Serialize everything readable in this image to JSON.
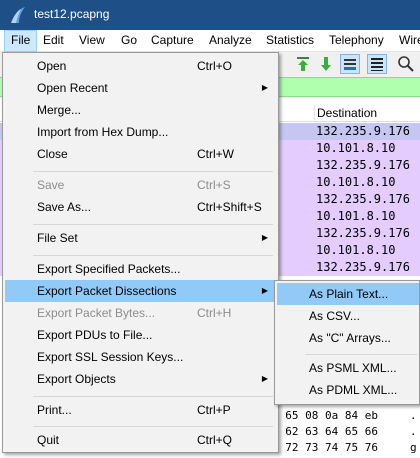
{
  "window": {
    "title": "test12.pcapng"
  },
  "menubar": {
    "items": [
      {
        "label": "File"
      },
      {
        "label": "Edit"
      },
      {
        "label": "View"
      },
      {
        "label": "Go"
      },
      {
        "label": "Capture"
      },
      {
        "label": "Analyze"
      },
      {
        "label": "Statistics"
      },
      {
        "label": "Telephony"
      },
      {
        "label": "Wire"
      }
    ]
  },
  "packet_list": {
    "destination_header": "Destination",
    "rows": [
      {
        "destination": "132.235.9.176",
        "color": "#c6c6f2"
      },
      {
        "destination": "10.101.8.10",
        "color": "#e4ccff"
      },
      {
        "destination": "132.235.9.176",
        "color": "#e4ccff"
      },
      {
        "destination": "10.101.8.10",
        "color": "#e4ccff"
      },
      {
        "destination": "132.235.9.176",
        "color": "#e4ccff"
      },
      {
        "destination": "10.101.8.10",
        "color": "#e4ccff"
      },
      {
        "destination": "132.235.9.176",
        "color": "#e4ccff"
      },
      {
        "destination": "10.101.8.10",
        "color": "#e4ccff"
      },
      {
        "destination": "132.235.9.176",
        "color": "#e4ccff"
      }
    ]
  },
  "bytes_pane": {
    "lines": [
      {
        "hex": "a 65 08 0a 84 eb",
        "ascii": "."
      },
      {
        "hex": "1 62 63 64 65 66",
        "ascii": "."
      },
      {
        "hex": "1 72 73 74 75 76",
        "ascii": "g"
      }
    ]
  },
  "file_menu": {
    "open": {
      "label": "Open",
      "shortcut": "Ctrl+O"
    },
    "open_recent": {
      "label": "Open Recent"
    },
    "merge": {
      "label": "Merge..."
    },
    "import_hex": {
      "label": "Import from Hex Dump..."
    },
    "close": {
      "label": "Close",
      "shortcut": "Ctrl+W"
    },
    "save": {
      "label": "Save",
      "shortcut": "Ctrl+S"
    },
    "save_as": {
      "label": "Save As...",
      "shortcut": "Ctrl+Shift+S"
    },
    "file_set": {
      "label": "File Set"
    },
    "export_specified": {
      "label": "Export Specified Packets..."
    },
    "export_dissections": {
      "label": "Export Packet Dissections"
    },
    "export_bytes": {
      "label": "Export Packet Bytes...",
      "shortcut": "Ctrl+H"
    },
    "export_pdus": {
      "label": "Export PDUs to File..."
    },
    "export_ssl": {
      "label": "Export SSL Session Keys..."
    },
    "export_objects": {
      "label": "Export Objects"
    },
    "print": {
      "label": "Print...",
      "shortcut": "Ctrl+P"
    },
    "quit": {
      "label": "Quit",
      "shortcut": "Ctrl+Q"
    }
  },
  "export_submenu": {
    "plain_text": {
      "label": "As Plain Text..."
    },
    "csv": {
      "label": "As CSV..."
    },
    "c_arrays": {
      "label": "As \"C\" Arrays..."
    },
    "psml": {
      "label": "As PSML XML..."
    },
    "pdml": {
      "label": "As PDML XML..."
    }
  },
  "icons": {
    "app": "wireshark-fin-icon",
    "submenu_arrow": "triangle-right-icon"
  },
  "colors": {
    "title_bar": "#1e4f86",
    "menu_highlight": "#91c9f7",
    "filter_bar": "#afffaf",
    "row_selected": "#c6c6f2",
    "row_tcp": "#e4ccff"
  }
}
